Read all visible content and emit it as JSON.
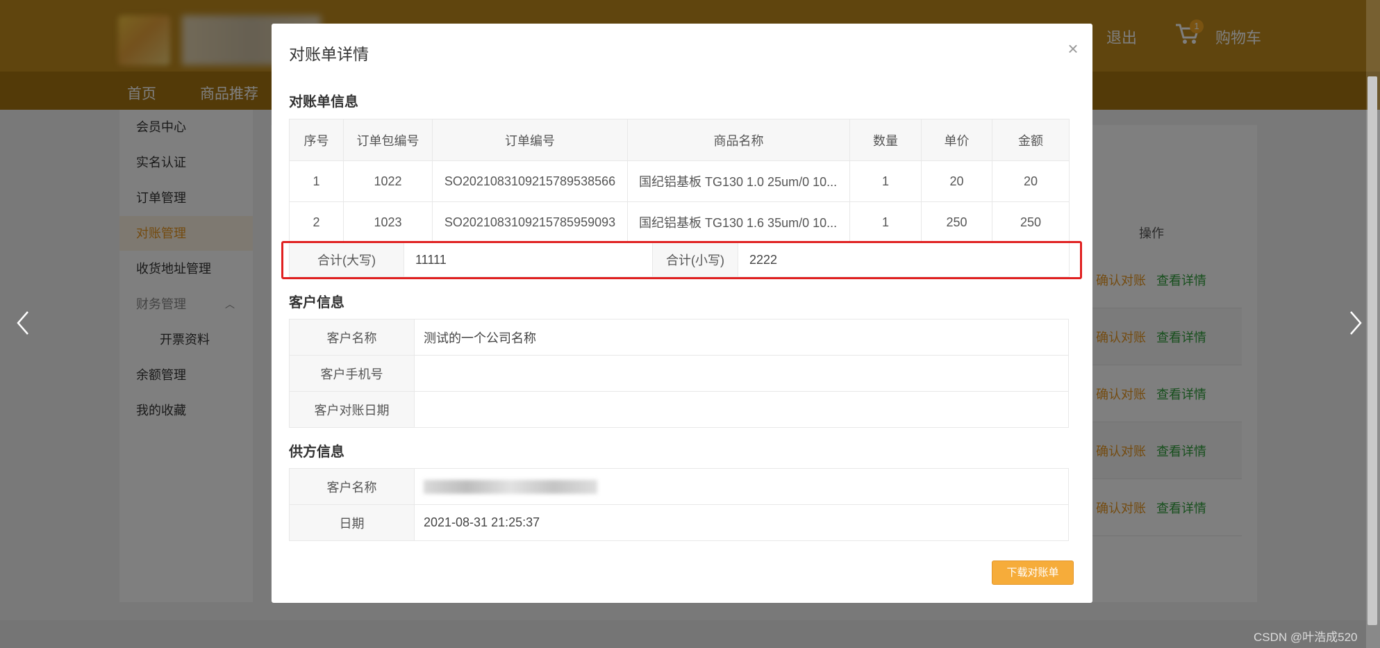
{
  "header": {
    "logout_label": "退出",
    "cart_label": "购物车",
    "cart_count": "1"
  },
  "nav": {
    "home": "首页",
    "recommend": "商品推荐"
  },
  "sidebar": {
    "items": [
      {
        "label": "会员中心"
      },
      {
        "label": "实名认证"
      },
      {
        "label": "订单管理"
      },
      {
        "label": "对账管理"
      },
      {
        "label": "收货地址管理"
      },
      {
        "label": "财务管理"
      },
      {
        "label": "开票资料"
      },
      {
        "label": "余额管理"
      },
      {
        "label": "我的收藏"
      }
    ]
  },
  "background_table": {
    "op_header": "操作",
    "confirm_label": "确认对账",
    "detail_label": "查看详情"
  },
  "modal": {
    "title": "对账单详情",
    "close_symbol": "×",
    "statement_section": "对账单信息",
    "columns": [
      "序号",
      "订单包编号",
      "订单编号",
      "商品名称",
      "数量",
      "单价",
      "金额"
    ],
    "rows": [
      {
        "no": "1",
        "package": "1022",
        "order": "SO2021083109215789538566",
        "product": "国纪铝基板 TG130 1.0 25um/0 10...",
        "qty": "1",
        "price": "20",
        "amount": "20"
      },
      {
        "no": "2",
        "package": "1023",
        "order": "SO2021083109215785959093",
        "product": "国纪铝基板 TG130 1.6 35um/0 10...",
        "qty": "1",
        "price": "250",
        "amount": "250"
      }
    ],
    "total_upper_label": "合计(大写)",
    "total_upper_value": "11111",
    "total_lower_label": "合计(小写)",
    "total_lower_value": "2222",
    "customer_section": "客户信息",
    "customer": {
      "name_label": "客户名称",
      "name_value": "测试的一个公司名称",
      "phone_label": "客户手机号",
      "phone_value": "",
      "date_label": "客户对账日期",
      "date_value": ""
    },
    "supplier_section": "供方信息",
    "supplier": {
      "name_label": "客户名称",
      "date_label": "日期",
      "date_value": "2021-08-31 21:25:37"
    },
    "download_label": "下载对账单"
  },
  "watermark": "CSDN @叶浩成520",
  "colors": {
    "brand_top": "#c08a1d",
    "brand_nav": "#a67410",
    "accent_orange": "#e8961e",
    "detail_green": "#2e9e3a",
    "highlight_red": "#e02020",
    "button_orange": "#f6ac3a"
  }
}
